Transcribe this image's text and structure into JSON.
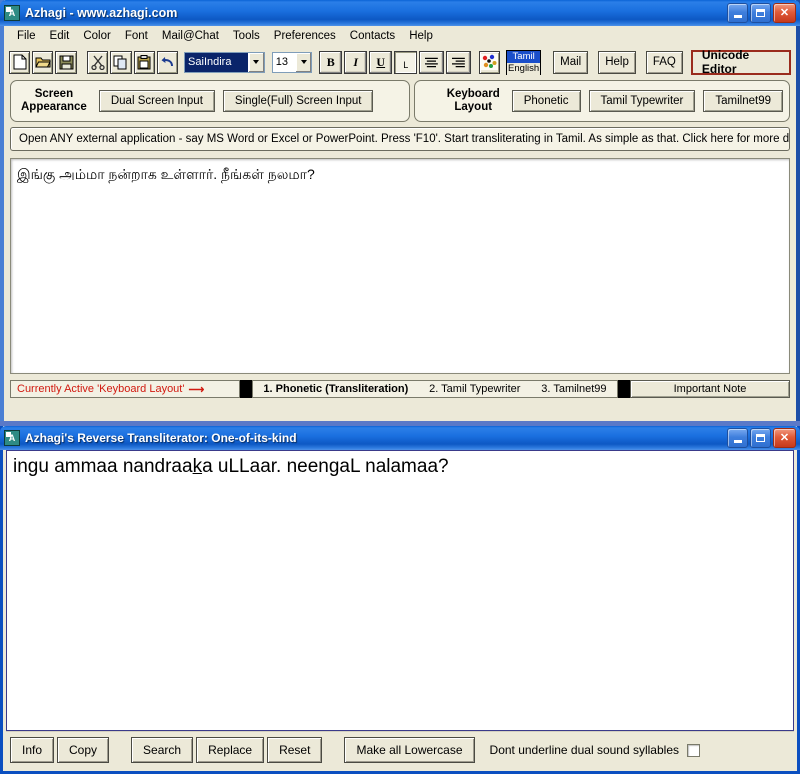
{
  "main_window": {
    "title": "Azhagi - www.azhagi.com",
    "icon": "azhagi-app-icon",
    "window_controls": {
      "minimize": "minimize-icon",
      "maximize": "maximize-icon",
      "close": "close-icon"
    },
    "menu": [
      {
        "label": "File"
      },
      {
        "label": "Edit"
      },
      {
        "label": "Color"
      },
      {
        "label": "Font"
      },
      {
        "label": "Mail@Chat"
      },
      {
        "label": "Tools"
      },
      {
        "label": "Preferences"
      },
      {
        "label": "Contacts"
      },
      {
        "label": "Help"
      }
    ],
    "toolbar": {
      "new_icon": "new-document-icon",
      "open_icon": "open-folder-icon",
      "save_icon": "save-disk-icon",
      "cut_icon": "cut-scissors-icon",
      "copy_icon": "copy-icon",
      "paste_icon": "paste-clipboard-icon",
      "undo_icon": "undo-arrow-icon",
      "font_name": "SaiIndira",
      "font_size": "13",
      "bold_label": "B",
      "italic_label": "I",
      "underline_label": "U",
      "left_label": "L",
      "align_center_icon": "align-center-icon",
      "align_right_icon": "align-right-icon",
      "palette_icon": "color-palette-icon",
      "lang_top": "Tamil",
      "lang_bottom": "English",
      "mail_label": "Mail",
      "help_label": "Help",
      "faq_label": "FAQ",
      "unicode_label": "Unicode Editor"
    },
    "screen_appearance": {
      "label_line1": "Screen",
      "label_line2": "Appearance",
      "buttons": [
        {
          "label": "Dual Screen Input"
        },
        {
          "label": "Single(Full) Screen Input"
        }
      ]
    },
    "keyboard_layout": {
      "label_line1": "Keyboard",
      "label_line2": "Layout",
      "buttons": [
        {
          "label": "Phonetic"
        },
        {
          "label": "Tamil Typewriter"
        },
        {
          "label": "Tamilnet99"
        }
      ]
    },
    "info_banner": "Open ANY external application - say MS Word or Excel or PowerPoint. Press 'F10'. Start transliterating in Tamil. As simple as that. Click here for more details...",
    "editor_text": "இங்கு அம்மா நன்றாக உள்ளார். நீங்கள் நலமா?",
    "status": {
      "active_label": "Currently Active 'Keyboard Layout'",
      "arrow": "⟶",
      "layouts": [
        {
          "label": "1. Phonetic (Transliteration)",
          "active": true
        },
        {
          "label": "2. Tamil Typewriter",
          "active": false
        },
        {
          "label": "3. Tamilnet99",
          "active": false
        }
      ],
      "note_button": "Important Note"
    }
  },
  "reverse_window": {
    "title": "Azhagi's Reverse Transliterator: One-of-its-kind",
    "icon": "azhagi-app-icon",
    "window_controls": {
      "minimize": "minimize-icon",
      "maximize": "maximize-icon",
      "close": "close-icon"
    },
    "text_before_underline": "ingu ammaa nandraa",
    "underlined_char": "k",
    "text_after_underline": "a uLLaar. neengaL nalamaa?",
    "buttons": [
      {
        "label": "Info"
      },
      {
        "label": "Copy"
      },
      {
        "label": "Search"
      },
      {
        "label": "Replace"
      },
      {
        "label": "Reset"
      },
      {
        "label": "Make all Lowercase"
      }
    ],
    "checkbox_label": "Dont underline dual sound syllables",
    "checkbox_checked": false
  },
  "colors": {
    "titlebar_blue": "#0d58c4",
    "face": "#ece9d8",
    "accent_red": "#d11a10",
    "selection_blue": "#0a246a",
    "unicode_border": "#9a2b1c"
  }
}
